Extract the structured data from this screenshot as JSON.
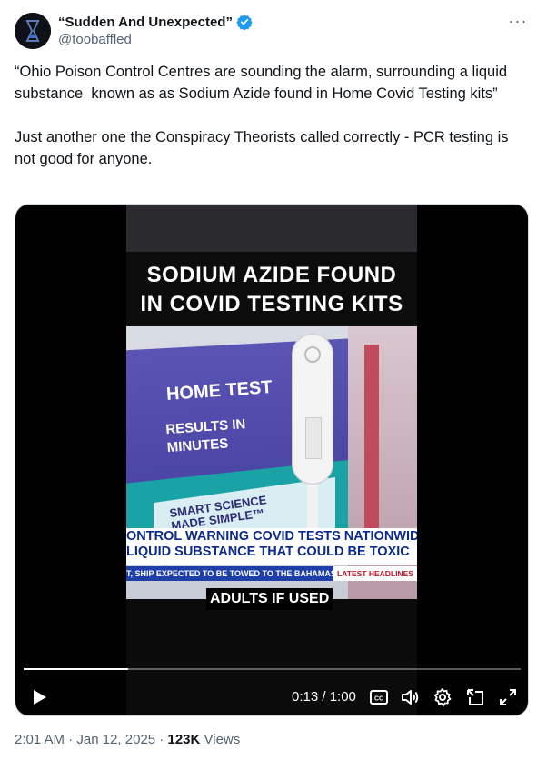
{
  "author": {
    "display_name": "“Sudden And Unexpected”",
    "handle": "@toobaffled",
    "verified": true,
    "verified_color": "#1d9bf0"
  },
  "more_label": "···",
  "tweet": {
    "text": "“Ohio Poison Control Centres are sounding the alarm, surrounding a liquid substance  known as as Sodium Azide found in Home Covid Testing kits”\n\nJust another one the Conspiracy Theorists called correctly - PCR testing is not good for anyone."
  },
  "video": {
    "overlay_title_line1": "SODIUM AZIDE FOUND",
    "overlay_title_line2": "IN COVID TESTING KITS",
    "box_text_1": "HOME TEST",
    "box_text_2": "RESULTS IN MINUTES",
    "box_text_3": "SMART SCIENCE MADE SIMPLE™",
    "lower_third_line1": "ONTROL WARNING COVID TESTS NATIONWIDE",
    "lower_third_line2": "LIQUID SUBSTANCE THAT COULD BE TOXIC",
    "ticker_text": "T, SHIP EXPECTED TO BE TOWED TO THE BAHAMAS",
    "ticker_tag": "LATEST HEADLINES",
    "subtitle": "ADULTS IF USED",
    "time_display": "0:13 / 1:00",
    "progress": 0.21
  },
  "meta": {
    "time": "2:01 AM",
    "separator": " · ",
    "date": "Jan 12, 2025",
    "views_count": "123K",
    "views_label": "Views"
  },
  "icons": [
    "avatar",
    "verified-badge-icon",
    "more-icon",
    "play-icon",
    "captions-icon",
    "volume-icon",
    "settings-gear-icon",
    "picture-in-picture-icon",
    "fullscreen-icon"
  ]
}
